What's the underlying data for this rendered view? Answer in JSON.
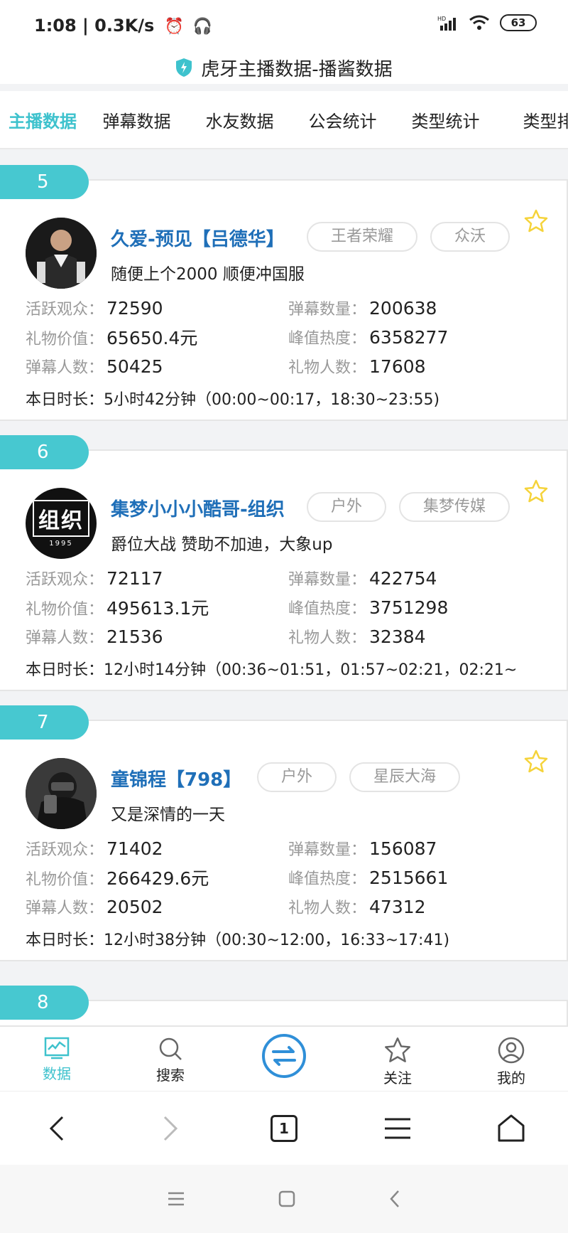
{
  "status_bar": {
    "time": "1:08 | 0.3K/s",
    "battery": "63"
  },
  "app": {
    "title": "虎牙主播数据-播酱数据"
  },
  "tabs": [
    {
      "label": "主播数据",
      "active": true
    },
    {
      "label": "弹幕数据"
    },
    {
      "label": "水友数据"
    },
    {
      "label": "公会统计"
    },
    {
      "label": "类型统计"
    },
    {
      "label": "类型排"
    }
  ],
  "stat_labels": {
    "viewers": "活跃观众：",
    "danmu_count": "弹幕数量：",
    "gift_value": "礼物价值：",
    "peak_heat": "峰值热度：",
    "danmu_users": "弹幕人数：",
    "gift_users": "礼物人数："
  },
  "streamers": [
    {
      "rank": "5",
      "name": "久爱-预见【吕德华】",
      "tags": [
        "王者荣耀",
        "众沃"
      ],
      "desc": "随便上个2000 顺便冲国服",
      "viewers": "72590",
      "danmu_count": "200638",
      "gift_value": "65650.4元",
      "peak_heat": "6358277",
      "danmu_users": "50425",
      "gift_users": "17608",
      "duration": "本日时长：5小时42分钟（00:00~00:17，18:30~23:55)"
    },
    {
      "rank": "6",
      "name": "集梦小小小酷哥-组织",
      "tags": [
        "户外",
        "集梦传媒"
      ],
      "desc": "爵位大战 赞助不加迪，大象up",
      "avatar_text": "组织",
      "avatar_sub": "1995",
      "viewers": "72117",
      "danmu_count": "422754",
      "gift_value": "495613.1元",
      "peak_heat": "3751298",
      "danmu_users": "21536",
      "gift_users": "32384",
      "duration": "本日时长：12小时14分钟（00:36~01:51，01:57~02:21，02:21~"
    },
    {
      "rank": "7",
      "name": "童锦程【798】",
      "tags": [
        "户外",
        "星辰大海"
      ],
      "desc": "又是深情的一天",
      "viewers": "71402",
      "danmu_count": "156087",
      "gift_value": "266429.6元",
      "peak_heat": "2515661",
      "danmu_users": "20502",
      "gift_users": "47312",
      "duration": "本日时长：12小时38分钟（00:30~12:00，16:33~17:41)"
    },
    {
      "rank": "8"
    }
  ],
  "bottom_nav": [
    {
      "label": "数据",
      "icon": "chart-icon",
      "active": true
    },
    {
      "label": "搜索",
      "icon": "search-icon"
    },
    {
      "label": "",
      "icon": "switch-icon"
    },
    {
      "label": "关注",
      "icon": "star-icon"
    },
    {
      "label": "我的",
      "icon": "user-icon"
    }
  ],
  "browser": {
    "tab_count": "1"
  },
  "colors": {
    "accent": "#3ec2cd",
    "badge": "#47c8d0",
    "name": "#1f6fb8",
    "star": "#f5d33a"
  }
}
